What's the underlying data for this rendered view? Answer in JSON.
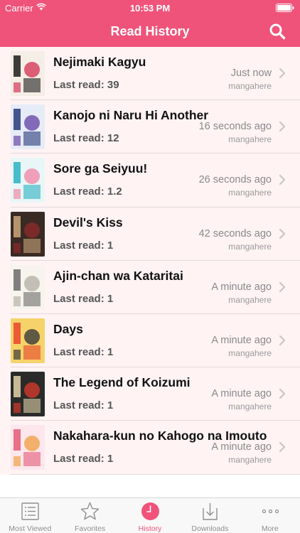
{
  "status_bar": {
    "carrier": "Carrier",
    "time": "10:53 PM"
  },
  "nav": {
    "title": "Read History"
  },
  "items": [
    {
      "title": "Nejimaki Kagyu",
      "last_read": "Last read: 39",
      "time_ago": "Just now",
      "source": "mangahere",
      "colors": [
        "#f4eee6",
        "#1c1c1c",
        "#d4385a"
      ]
    },
    {
      "title": "Kanojo ni Naru Hi Another",
      "last_read": "Last read: 12",
      "time_ago": "16 seconds ago",
      "source": "mangahere",
      "colors": [
        "#e6ecf7",
        "#283a7a",
        "#6a4aa8"
      ]
    },
    {
      "title": "Sore ga Seiyuu!",
      "last_read": "Last read: 1.2",
      "time_ago": "26 seconds ago",
      "source": "mangahere",
      "colors": [
        "#e9f6f7",
        "#2ab3c3",
        "#f08aa6"
      ]
    },
    {
      "title": "Devil's Kiss",
      "last_read": "Last read: 1",
      "time_ago": "42 seconds ago",
      "source": "mangahere",
      "colors": [
        "#3a2a24",
        "#c9a77a",
        "#8a2a2a"
      ]
    },
    {
      "title": "Ajin-chan wa Kataritai",
      "last_read": "Last read: 1",
      "time_ago": "A minute ago",
      "source": "mangahere",
      "colors": [
        "#f7f4ee",
        "#6a6a6a",
        "#b7b2a8"
      ]
    },
    {
      "title": "Days",
      "last_read": "Last read: 1",
      "time_ago": "A minute ago",
      "source": "mangahere",
      "colors": [
        "#f6d36a",
        "#e7452d",
        "#3a3a3a"
      ]
    },
    {
      "title": "The Legend of Koizumi",
      "last_read": "Last read: 1",
      "time_ago": "A minute ago",
      "source": "mangahere",
      "colors": [
        "#2a2a2a",
        "#e0d3a8",
        "#d23a2a"
      ]
    },
    {
      "title": "Nakahara-kun no Kahogo na Imouto",
      "last_read": "Last read: 1",
      "time_ago": "A minute ago",
      "source": "mangahere",
      "colors": [
        "#fde7ec",
        "#e35a7a",
        "#f0a24a"
      ]
    }
  ],
  "tabs": [
    {
      "label": "Most Viewed",
      "icon": "list-icon",
      "active": false
    },
    {
      "label": "Favorites",
      "icon": "star-icon",
      "active": false
    },
    {
      "label": "History",
      "icon": "clock-icon",
      "active": true
    },
    {
      "label": "Downloads",
      "icon": "download-icon",
      "active": false
    },
    {
      "label": "More",
      "icon": "more-icon",
      "active": false
    }
  ],
  "colors": {
    "accent": "#f0537a",
    "row_bg": "#fff3f4",
    "tab_inactive": "#8e8e8e"
  }
}
